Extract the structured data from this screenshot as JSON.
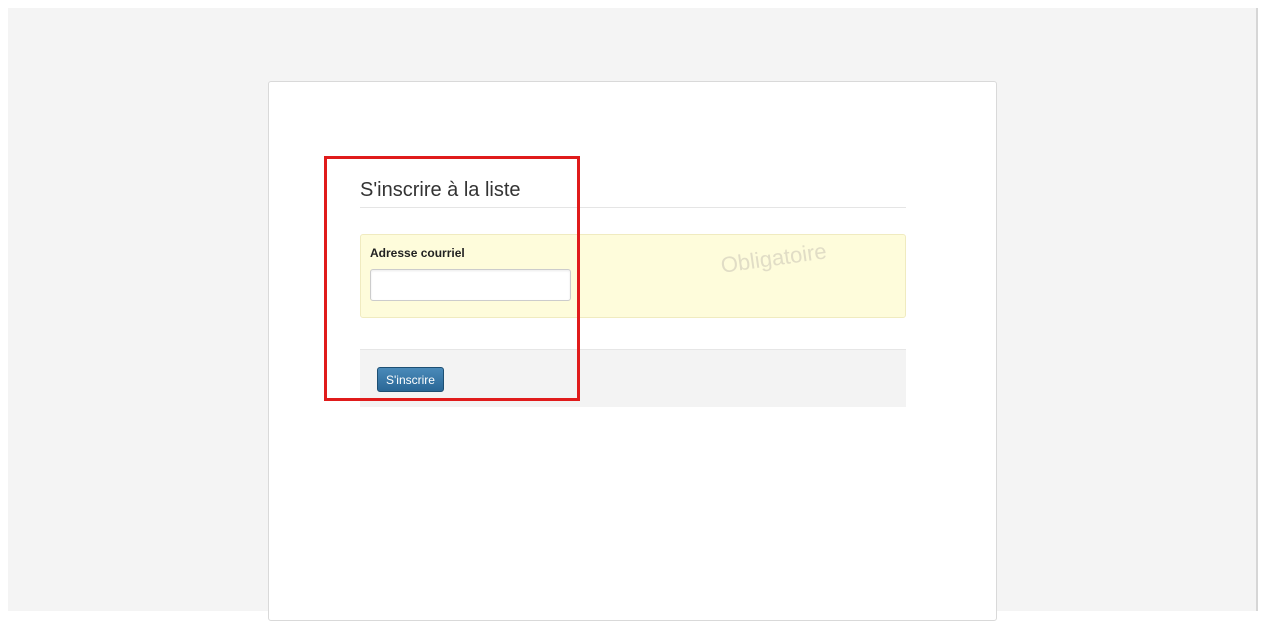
{
  "form": {
    "title": "S'inscrire à la liste",
    "email_label": "Adresse courriel",
    "email_value": "",
    "email_placeholder": "",
    "required_note": "Obligatoire",
    "submit_label": "S'inscrire"
  },
  "colors": {
    "field_background": "#fefcdb",
    "button": "#2a6796",
    "highlight": "#e01b1b"
  }
}
